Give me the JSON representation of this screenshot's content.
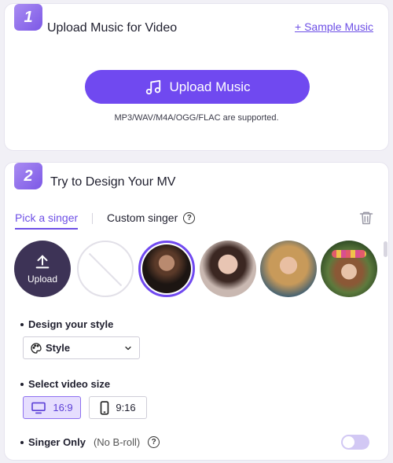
{
  "step1": {
    "badge": "1",
    "title": "Upload Music for Video",
    "sample_link": "+ Sample Music",
    "upload_button": "Upload Music",
    "supported_formats": "MP3/WAV/M4A/OGG/FLAC are supported."
  },
  "step2": {
    "badge": "2",
    "title": "Try to Design Your MV",
    "tabs": [
      "Pick a singer",
      "Custom singer"
    ],
    "active_tab": "Pick a singer",
    "upload_avatar_label": "Upload",
    "selected_avatar_index": 2,
    "design_style_label": "Design your style",
    "style_select_value": "Style",
    "video_size_label": "Select video size",
    "video_sizes": [
      "16:9",
      "9:16"
    ],
    "selected_video_size": "16:9",
    "singer_only_label": "Singer Only",
    "singer_only_note": "(No B-roll)",
    "singer_only_enabled": false
  },
  "colors": {
    "accent": "#7049f0",
    "link": "#6d4fe6",
    "upload_avatar_bg": "#3d3356"
  },
  "icons": [
    "music-note-icon",
    "help-icon",
    "trash-icon",
    "upload-arrow-icon",
    "palette-icon",
    "chevron-down-icon",
    "monitor-icon",
    "phone-icon"
  ]
}
